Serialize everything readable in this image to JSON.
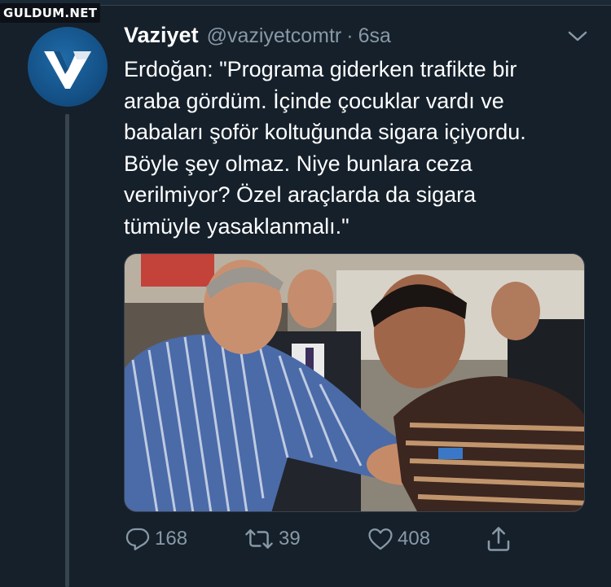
{
  "watermark": "GULDUM.NET",
  "tweet": {
    "display_name": "Vaziyet",
    "handle": "@vaziyetcomtr",
    "separator": "·",
    "time": "6sa",
    "text": "Erdoğan: \"Programa giderken trafikte bir\naraba gördüm. İçinde çocuklar vardı ve\nbabaları şoför koltuğunda sigara içiyordu.\nBöyle şey olmaz. Niye bunlara ceza\nverilmiyor? Özel araçlarda da sigara\ntümüyle yasaklanmalı.\""
  },
  "actions": {
    "reply_count": "168",
    "retweet_count": "39",
    "like_count": "408"
  },
  "icons": {
    "avatar": "vaziyet-logo-icon",
    "caret": "chevron-down-icon",
    "reply": "reply-icon",
    "retweet": "retweet-icon",
    "like": "heart-icon",
    "share": "share-icon"
  },
  "colors": {
    "background": "#15202b",
    "secondary_text": "#8899a6",
    "primary_text": "#ffffff",
    "avatar_blue": "#145187",
    "divider": "#38444d"
  }
}
